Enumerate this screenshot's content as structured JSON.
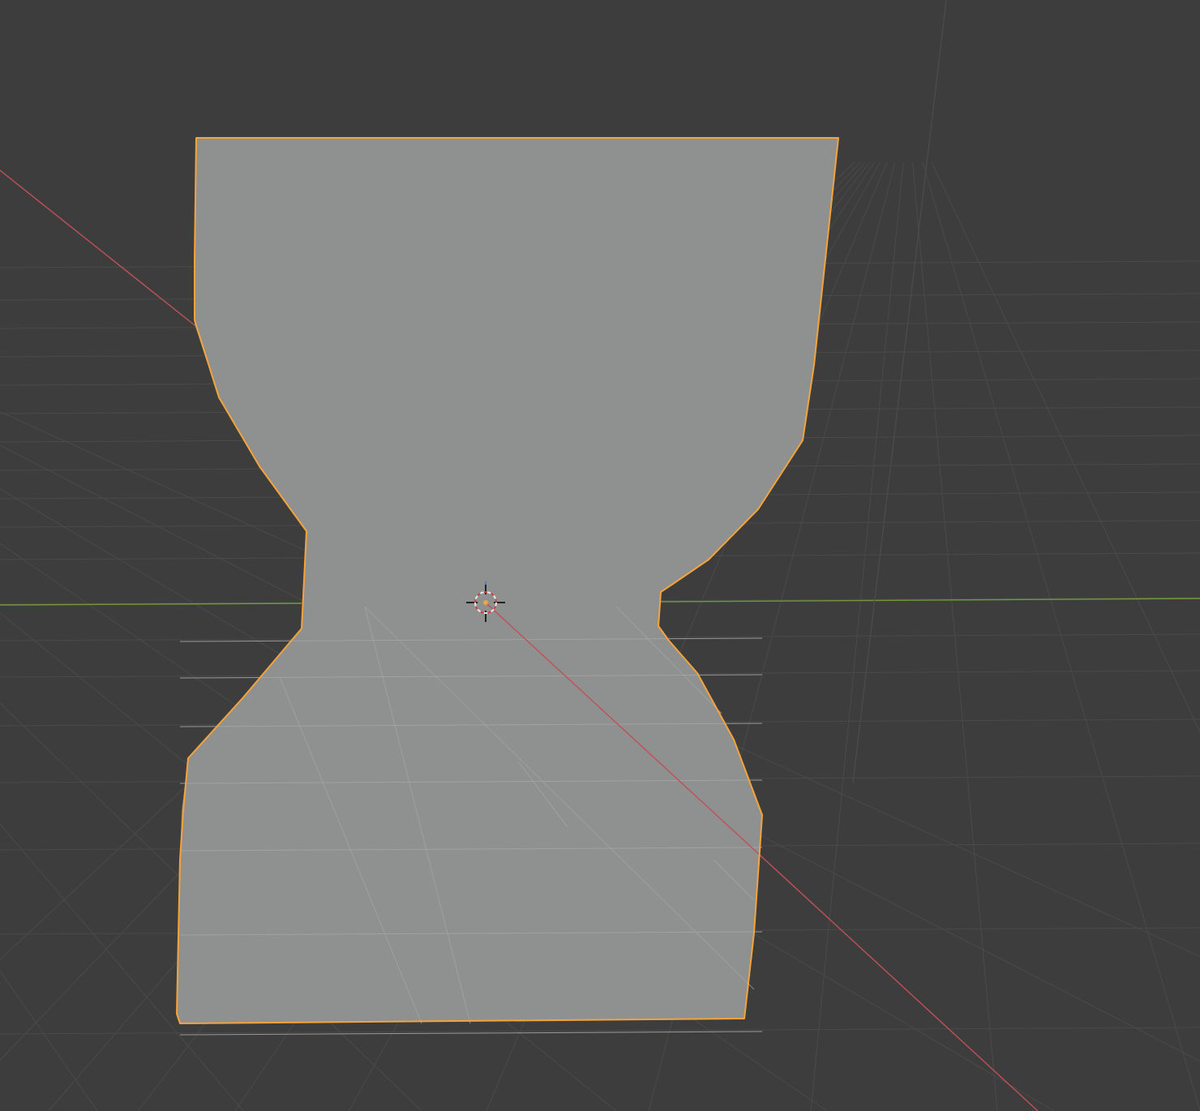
{
  "app": {
    "name": "",
    "view": "3d-viewport"
  },
  "viewport": {
    "background_color": "#3d3d3d",
    "grid_color": "#4a4a4a",
    "x_axis_color": "#c0505a",
    "y_axis_color": "#6f9a3a",
    "selection_outline_color": "#f5a33a",
    "object_fill_color": "#8f9090",
    "object_shade_color": "#7a7b7b",
    "grid_visible": true
  },
  "scene": {
    "selected_object": {
      "shape": "hourglass-profile-mesh",
      "selected": true
    },
    "origin_marker": {
      "icon": "3d-cursor-icon"
    }
  }
}
